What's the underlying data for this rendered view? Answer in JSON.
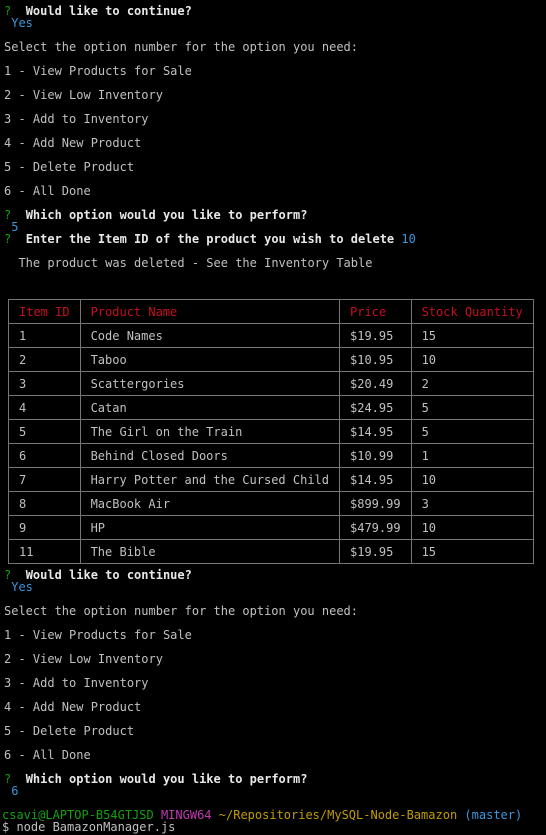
{
  "prompt_marker": "?",
  "block1": {
    "continue_q": "Would like to continue?",
    "continue_a": "Yes",
    "select_text": "Select the option number for the option you need:",
    "options": [
      "1 - View Products for Sale",
      "2 - View Low Inventory",
      "3 - Add to Inventory",
      "4 - Add New Product",
      "5 - Delete Product",
      "6 - All Done"
    ],
    "perform_q": "Which option would you like to perform?",
    "perform_a": "5",
    "delete_q": "Enter the Item ID of the product you wish to delete",
    "delete_a": "10",
    "deleted_msg": "The product was deleted - See the Inventory Table"
  },
  "table": {
    "headers": [
      "Item ID",
      "Product Name",
      "Price",
      "Stock Quantity"
    ],
    "rows": [
      [
        "1",
        "Code Names",
        "$19.95",
        "15"
      ],
      [
        "2",
        "Taboo",
        "$10.95",
        "10"
      ],
      [
        "3",
        "Scattergories",
        "$20.49",
        "2"
      ],
      [
        "4",
        "Catan",
        "$24.95",
        "5"
      ],
      [
        "5",
        "The Girl on the Train",
        "$14.95",
        "5"
      ],
      [
        "6",
        "Behind Closed Doors",
        "$10.99",
        "1"
      ],
      [
        "7",
        "Harry Potter and the Cursed Child",
        "$14.95",
        "10"
      ],
      [
        "8",
        "MacBook Air",
        "$899.99",
        "3"
      ],
      [
        "9",
        "HP",
        "$479.99",
        "10"
      ],
      [
        "11",
        "The Bible",
        "$19.95",
        "15"
      ]
    ]
  },
  "block2": {
    "continue_q": "Would like to continue?",
    "continue_a": "Yes",
    "select_text": "Select the option number for the option you need:",
    "options": [
      "1 - View Products for Sale",
      "2 - View Low Inventory",
      "3 - Add to Inventory",
      "4 - Add New Product",
      "5 - Delete Product",
      "6 - All Done"
    ],
    "perform_q": "Which option would you like to perform?",
    "perform_a": "6"
  },
  "shell_prompt": {
    "user_host": "csavi@LAPTOP-B54GTJSD",
    "system": "MINGW64",
    "path": "~/Repositories/MySQL-Node-Bamazon",
    "branch": "(master)",
    "command": "$ node BamazonManager.js"
  },
  "colors": {
    "background": "#000000",
    "text": "#c0c0c0",
    "prompt_green": "#13a10e",
    "answer_cyan": "#3a96dd",
    "header_red": "#c50f1f",
    "mingw_magenta": "#c239b3",
    "path_yellow": "#c19c00"
  }
}
